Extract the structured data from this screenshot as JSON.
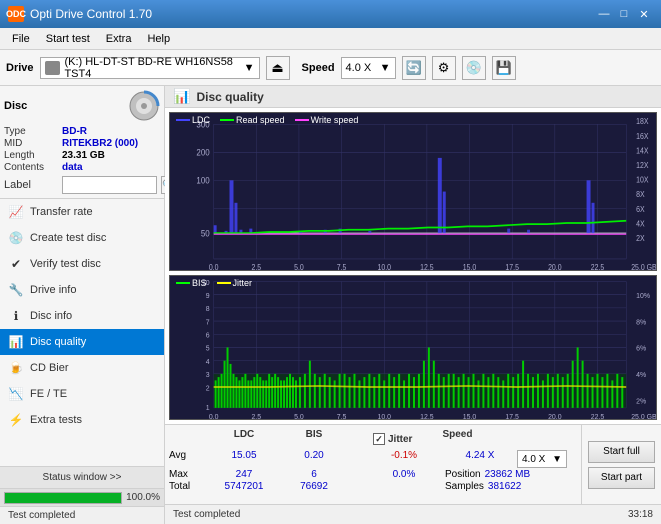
{
  "app": {
    "title": "Opti Drive Control 1.70",
    "icon": "ODC"
  },
  "title_controls": {
    "minimize": "—",
    "maximize": "□",
    "close": "✕"
  },
  "menu": {
    "items": [
      "File",
      "Start test",
      "Extra",
      "Help"
    ]
  },
  "toolbar": {
    "drive_label": "Drive",
    "drive_value": "(K:) HL-DT-ST BD-RE  WH16NS58 TST4",
    "speed_label": "Speed",
    "speed_value": "4.0 X"
  },
  "disc": {
    "title": "Disc",
    "type_label": "Type",
    "type_value": "BD-R",
    "mid_label": "MID",
    "mid_value": "RITEKBR2 (000)",
    "length_label": "Length",
    "length_value": "23.31 GB",
    "contents_label": "Contents",
    "contents_value": "data",
    "label_label": "Label",
    "label_input": ""
  },
  "nav": {
    "items": [
      {
        "id": "transfer-rate",
        "label": "Transfer rate",
        "icon": "📈"
      },
      {
        "id": "create-test-disc",
        "label": "Create test disc",
        "icon": "💿"
      },
      {
        "id": "verify-test-disc",
        "label": "Verify test disc",
        "icon": "✔"
      },
      {
        "id": "drive-info",
        "label": "Drive info",
        "icon": "🔧"
      },
      {
        "id": "disc-info",
        "label": "Disc info",
        "icon": "ℹ"
      },
      {
        "id": "disc-quality",
        "label": "Disc quality",
        "icon": "📊",
        "active": true
      },
      {
        "id": "cd-bier",
        "label": "CD Bier",
        "icon": "🍺"
      },
      {
        "id": "fe-te",
        "label": "FE / TE",
        "icon": "📉"
      },
      {
        "id": "extra-tests",
        "label": "Extra tests",
        "icon": "⚡"
      }
    ]
  },
  "status_window_btn": "Status window >>",
  "progress": {
    "value": 100,
    "text": "100.0%"
  },
  "status": {
    "text": "Test completed"
  },
  "content": {
    "title": "Disc quality",
    "icon": "📊"
  },
  "legend1": {
    "ldc_label": "LDC",
    "read_label": "Read speed",
    "write_label": "Write speed"
  },
  "legend2": {
    "bis_label": "BIS",
    "jitter_label": "Jitter"
  },
  "stats": {
    "headers": [
      "",
      "LDC",
      "BIS",
      "",
      "Jitter",
      "Speed",
      ""
    ],
    "avg_label": "Avg",
    "avg_ldc": "15.05",
    "avg_bis": "0.20",
    "avg_jitter": "-0.1%",
    "max_label": "Max",
    "max_ldc": "247",
    "max_bis": "6",
    "max_jitter": "0.0%",
    "total_label": "Total",
    "total_ldc": "5747201",
    "total_bis": "76692",
    "speed_label": "Speed",
    "speed_value": "4.24 X",
    "speed_select": "4.0 X",
    "position_label": "Position",
    "position_value": "23862 MB",
    "samples_label": "Samples",
    "samples_value": "381622",
    "jitter_checked": true,
    "jitter_label": "Jitter"
  },
  "buttons": {
    "start_full": "Start full",
    "start_part": "Start part"
  },
  "bottom": {
    "status_text": "Test completed",
    "time": "33:18"
  },
  "chart1": {
    "y_max": 300,
    "y_labels": [
      "300",
      "200",
      "100",
      "50"
    ],
    "x_labels": [
      "0.0",
      "2.5",
      "5.0",
      "7.5",
      "10.0",
      "12.5",
      "15.0",
      "17.5",
      "20.0",
      "22.5",
      "25.0 GB"
    ],
    "right_labels": [
      "18X",
      "16X",
      "14X",
      "12X",
      "10X",
      "8X",
      "6X",
      "4X",
      "2X"
    ]
  },
  "chart2": {
    "y_max": 10,
    "y_labels": [
      "10",
      "9",
      "8",
      "7",
      "6",
      "5",
      "4",
      "3",
      "2",
      "1"
    ],
    "x_labels": [
      "0.0",
      "2.5",
      "5.0",
      "7.5",
      "10.0",
      "12.5",
      "15.0",
      "17.5",
      "20.0",
      "22.5",
      "25.0 GB"
    ],
    "right_labels": [
      "10%",
      "8%",
      "6%",
      "4%",
      "2%"
    ]
  }
}
